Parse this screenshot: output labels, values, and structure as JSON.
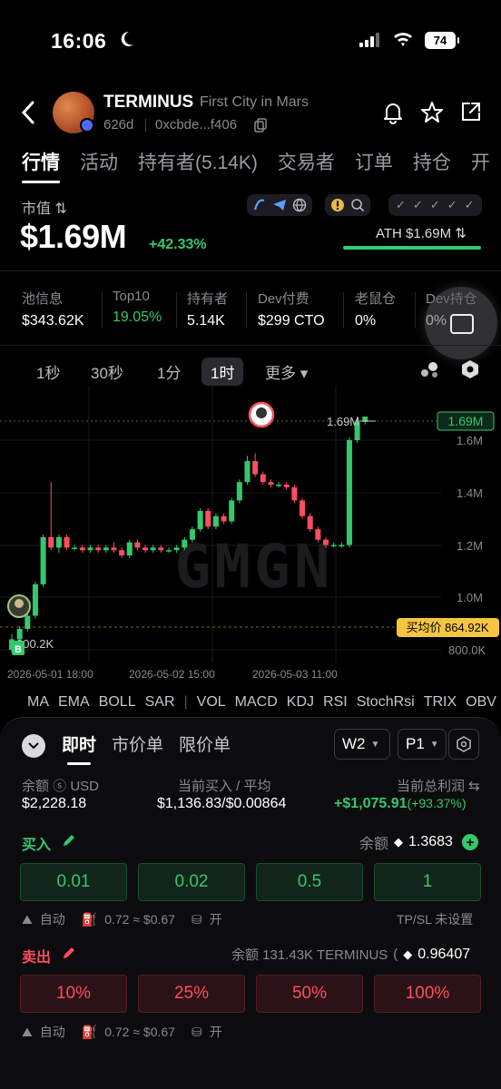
{
  "status_bar": {
    "time": "16:06",
    "battery": "74"
  },
  "token": {
    "name": "TERMINUS",
    "subtitle": "First City in Mars",
    "age": "626d",
    "address": "0xcbde...f406"
  },
  "tabs": [
    "行情",
    "活动",
    "持有者(5.14K)",
    "交易者",
    "订单",
    "持仓",
    "开"
  ],
  "market": {
    "label": "市值 ⇅",
    "value": "$1.69M",
    "change": "+42.33%",
    "ath_label": "ATH $1.69M ⇅"
  },
  "stats": [
    {
      "key": "池信息",
      "value": "$343.62K"
    },
    {
      "key": "Top10",
      "value": "19.05%"
    },
    {
      "key": "持有者",
      "value": "5.14K"
    },
    {
      "key": "Dev付费",
      "value": "$299 CTO"
    },
    {
      "key": "老鼠仓",
      "value": "0%"
    },
    {
      "key": "Dev持仓",
      "value": "0%"
    }
  ],
  "intervals": [
    "1秒",
    "30秒",
    "1分",
    "1时",
    "更多 ▾"
  ],
  "chart_data": {
    "type": "candlestick",
    "y_ticks": [
      "1.6M",
      "1.4M",
      "1.2M",
      "1.0M",
      "800.0K"
    ],
    "x_ticks": [
      "2026-05-01 18:00",
      "2026-05-02 15:00",
      "2026-05-03 11:00"
    ],
    "current_price_label": "1.69M",
    "high_marker_label": "1.69M",
    "low_marker_label": "800.2K",
    "avg_buy_label": "买均价 864.92K",
    "watermark": "GMGN",
    "buy_marker": "B",
    "colors": {
      "up": "#35c86b",
      "down": "#ff4d5e"
    },
    "candles": [
      {
        "o": 0.8,
        "c": 0.84,
        "h": 0.86,
        "l": 0.79
      },
      {
        "o": 0.84,
        "c": 0.88,
        "h": 0.89,
        "l": 0.83
      },
      {
        "o": 0.88,
        "c": 0.93,
        "h": 0.94,
        "l": 0.87
      },
      {
        "o": 0.93,
        "c": 1.05,
        "h": 1.06,
        "l": 0.92
      },
      {
        "o": 1.05,
        "c": 1.23,
        "h": 1.24,
        "l": 1.04
      },
      {
        "o": 1.23,
        "c": 1.19,
        "h": 1.44,
        "l": 1.18
      },
      {
        "o": 1.19,
        "c": 1.23,
        "h": 1.24,
        "l": 1.17
      },
      {
        "o": 1.23,
        "c": 1.19,
        "h": 1.24,
        "l": 1.18
      },
      {
        "o": 1.19,
        "c": 1.19,
        "h": 1.2,
        "l": 1.18
      },
      {
        "o": 1.19,
        "c": 1.18,
        "h": 1.2,
        "l": 1.17
      },
      {
        "o": 1.18,
        "c": 1.19,
        "h": 1.2,
        "l": 1.17
      },
      {
        "o": 1.19,
        "c": 1.18,
        "h": 1.2,
        "l": 1.17
      },
      {
        "o": 1.18,
        "c": 1.19,
        "h": 1.2,
        "l": 1.17
      },
      {
        "o": 1.19,
        "c": 1.18,
        "h": 1.21,
        "l": 1.17
      },
      {
        "o": 1.18,
        "c": 1.16,
        "h": 1.19,
        "l": 1.15
      },
      {
        "o": 1.16,
        "c": 1.21,
        "h": 1.22,
        "l": 1.15
      },
      {
        "o": 1.21,
        "c": 1.19,
        "h": 1.22,
        "l": 1.18
      },
      {
        "o": 1.19,
        "c": 1.18,
        "h": 1.2,
        "l": 1.17
      },
      {
        "o": 1.18,
        "c": 1.19,
        "h": 1.2,
        "l": 1.17
      },
      {
        "o": 1.19,
        "c": 1.18,
        "h": 1.2,
        "l": 1.17
      },
      {
        "o": 1.18,
        "c": 1.18,
        "h": 1.19,
        "l": 1.17
      },
      {
        "o": 1.18,
        "c": 1.19,
        "h": 1.2,
        "l": 1.17
      },
      {
        "o": 1.19,
        "c": 1.22,
        "h": 1.23,
        "l": 1.18
      },
      {
        "o": 1.22,
        "c": 1.26,
        "h": 1.27,
        "l": 1.21
      },
      {
        "o": 1.26,
        "c": 1.33,
        "h": 1.34,
        "l": 1.25
      },
      {
        "o": 1.33,
        "c": 1.27,
        "h": 1.34,
        "l": 1.26
      },
      {
        "o": 1.27,
        "c": 1.31,
        "h": 1.32,
        "l": 1.26
      },
      {
        "o": 1.31,
        "c": 1.29,
        "h": 1.32,
        "l": 1.28
      },
      {
        "o": 1.29,
        "c": 1.37,
        "h": 1.38,
        "l": 1.28
      },
      {
        "o": 1.37,
        "c": 1.44,
        "h": 1.45,
        "l": 1.36
      },
      {
        "o": 1.44,
        "c": 1.52,
        "h": 1.54,
        "l": 1.43
      },
      {
        "o": 1.52,
        "c": 1.47,
        "h": 1.55,
        "l": 1.46
      },
      {
        "o": 1.47,
        "c": 1.44,
        "h": 1.48,
        "l": 1.43
      },
      {
        "o": 1.44,
        "c": 1.43,
        "h": 1.45,
        "l": 1.42
      },
      {
        "o": 1.43,
        "c": 1.43,
        "h": 1.44,
        "l": 1.42
      },
      {
        "o": 1.43,
        "c": 1.42,
        "h": 1.44,
        "l": 1.41
      },
      {
        "o": 1.42,
        "c": 1.37,
        "h": 1.43,
        "l": 1.36
      },
      {
        "o": 1.37,
        "c": 1.31,
        "h": 1.38,
        "l": 1.3
      },
      {
        "o": 1.31,
        "c": 1.26,
        "h": 1.32,
        "l": 1.25
      },
      {
        "o": 1.26,
        "c": 1.22,
        "h": 1.27,
        "l": 1.21
      },
      {
        "o": 1.22,
        "c": 1.2,
        "h": 1.23,
        "l": 1.19
      },
      {
        "o": 1.2,
        "c": 1.2,
        "h": 1.21,
        "l": 1.19
      },
      {
        "o": 1.2,
        "c": 1.2,
        "h": 1.21,
        "l": 1.19
      },
      {
        "o": 1.2,
        "c": 1.6,
        "h": 1.61,
        "l": 1.19
      },
      {
        "o": 1.6,
        "c": 1.67,
        "h": 1.69,
        "l": 1.59
      },
      {
        "o": 1.67,
        "c": 1.69,
        "h": 1.69,
        "l": 1.66
      }
    ]
  },
  "indicators": [
    "MA",
    "EMA",
    "BOLL",
    "SAR",
    "|",
    "VOL",
    "MACD",
    "KDJ",
    "RSI",
    "StochRsi",
    "TRIX",
    "OBV"
  ],
  "panel": {
    "tabs": [
      "即时",
      "市价单",
      "限价单"
    ],
    "wallet": "W2",
    "preset": "P1",
    "balance_label": "余额 ⓢ USD",
    "balance_value": "$2,228.18",
    "buy_avg_label": "当前买入 / 平均",
    "buy_avg_value": "$1,136.83/$0.00864",
    "pnl_label": "当前总利润 ⇆",
    "pnl_value": "+$1,075.91",
    "pnl_pct": "(+93.37%)",
    "buy": {
      "title": "买入",
      "balance_label": "余额",
      "balance_value": "1.3683",
      "amounts": [
        "0.01",
        "0.02",
        "0.5",
        "1"
      ],
      "auto": "自动",
      "gas": "0.72 ≈ $0.67",
      "toggle": "开",
      "tpsl": "TP/SL 未设置"
    },
    "sell": {
      "title": "卖出",
      "balance_label": "余额 131.43K TERMINUS",
      "balance_value": "0.96407",
      "amounts": [
        "10%",
        "25%",
        "50%",
        "100%"
      ],
      "auto": "自动",
      "gas": "0.72 ≈ $0.67",
      "toggle": "开"
    }
  }
}
